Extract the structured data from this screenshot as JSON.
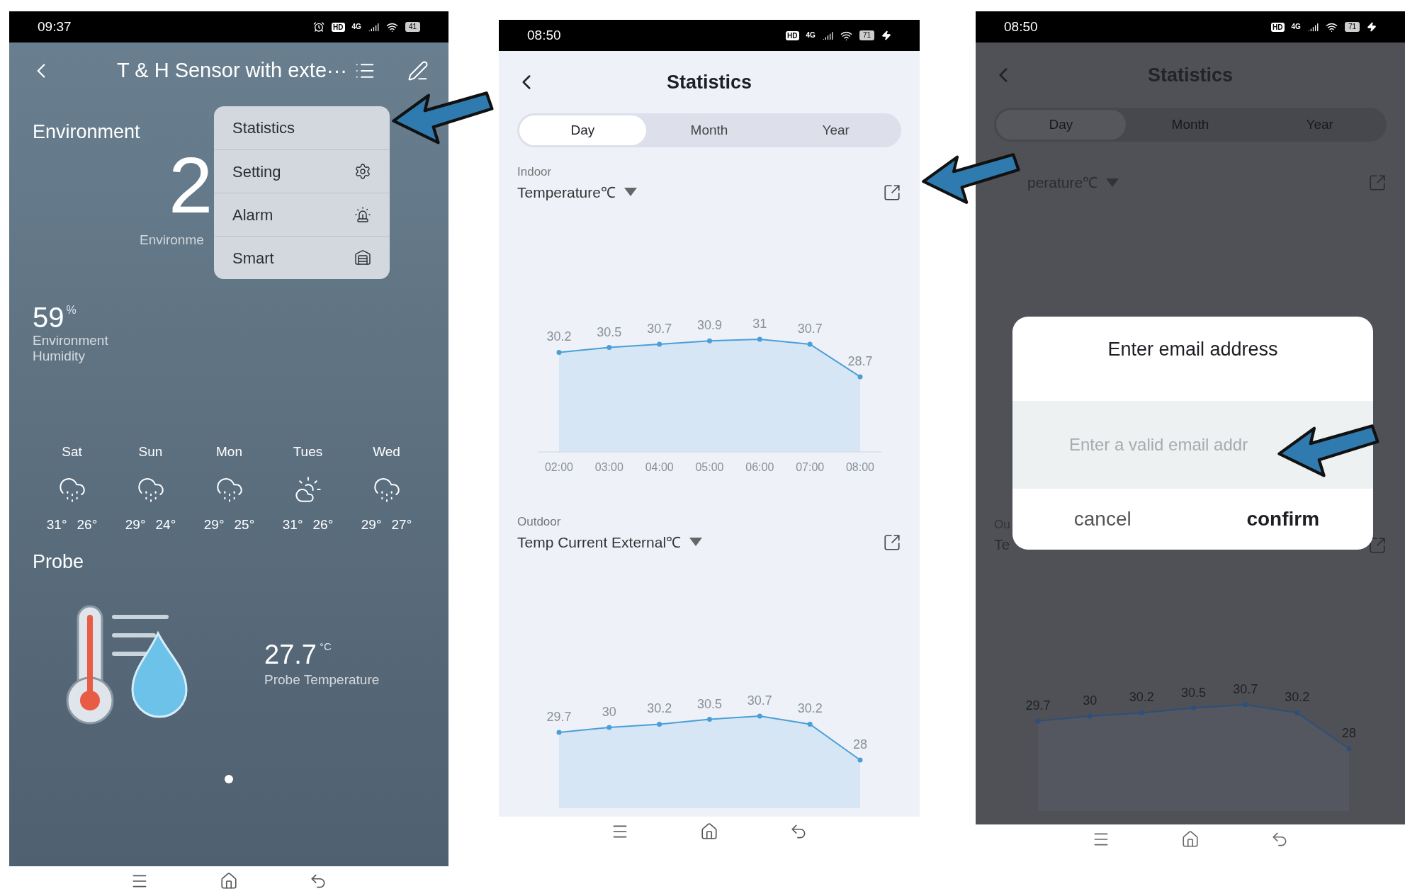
{
  "device_screen": {
    "status_bar": {
      "time": "09:37",
      "alarm": true,
      "hd": "HD",
      "network": "4G",
      "battery": "41"
    },
    "title": "T & H Sensor with exte···",
    "environment": {
      "heading": "Environment",
      "value": "2",
      "label": "Environme"
    },
    "menu": [
      {
        "label": "Statistics",
        "kind": "none"
      },
      {
        "label": "Setting",
        "kind": "gear"
      },
      {
        "label": "Alarm",
        "kind": "siren"
      },
      {
        "label": "Smart",
        "kind": "home"
      }
    ],
    "humidity": {
      "value": "59",
      "unit": "%",
      "label": "Environment Humidity"
    },
    "forecast": [
      {
        "day": "Sat",
        "kind": "rain",
        "high": "31°",
        "low": "26°"
      },
      {
        "day": "Sun",
        "kind": "rain",
        "high": "29°",
        "low": "24°"
      },
      {
        "day": "Mon",
        "kind": "rain",
        "high": "29°",
        "low": "25°"
      },
      {
        "day": "Tues",
        "kind": "sun_cloud",
        "high": "31°",
        "low": "26°"
      },
      {
        "day": "Wed",
        "kind": "rain",
        "high": "29°",
        "low": "27°"
      }
    ],
    "probe": {
      "heading": "Probe",
      "value": "27.7",
      "unit": "°C",
      "label": "Probe Temperature"
    }
  },
  "statistics_screen": {
    "status_bar": {
      "time": "08:50",
      "hd": "HD",
      "network": "4G",
      "battery": "71",
      "charging": true
    },
    "title": "Statistics",
    "tabs": [
      {
        "label": "Day",
        "selected": true
      },
      {
        "label": "Month",
        "selected": false
      },
      {
        "label": "Year",
        "selected": false
      }
    ],
    "indoor": {
      "label": "Indoor",
      "metric": "Temperature℃",
      "chart_data": {
        "type": "line",
        "categories": [
          "02:00",
          "03:00",
          "04:00",
          "05:00",
          "06:00",
          "07:00",
          "08:00"
        ],
        "data_labels": true,
        "series": [
          {
            "color": "#4a9fd8",
            "marker": true,
            "values": [
              30.2,
              30.5,
              30.7,
              30.9,
              31,
              30.7,
              28.7
            ]
          }
        ]
      }
    },
    "outdoor": {
      "label": "Outdoor",
      "metric": "Temp Current External℃",
      "chart_data": {
        "type": "line",
        "data_labels": true,
        "series": [
          {
            "color": "#4a9fd8",
            "marker": true,
            "values": [
              29.7,
              30,
              30.2,
              30.5,
              30.7,
              30.2,
              28
            ]
          }
        ]
      }
    }
  },
  "email_dialog_screen": {
    "status_bar": {
      "time": "08:50",
      "hd": "HD",
      "network": "4G",
      "battery": "71",
      "charging": true
    },
    "title": "Statistics",
    "tabs": [
      {
        "label": "Day",
        "selected": true
      },
      {
        "label": "Month",
        "selected": false
      },
      {
        "label": "Year",
        "selected": false
      }
    ],
    "indoor_metric": "perature℃",
    "outdoor_label": "Ou",
    "outdoor_metric": "Te",
    "chart_data": {
      "type": "line",
      "data_labels": true,
      "series": [
        {
          "color": "#2e4f7a",
          "marker": true,
          "values": [
            29.7,
            30,
            30.2,
            30.5,
            30.7,
            30.2,
            28
          ]
        }
      ]
    },
    "dialog": {
      "title": "Enter email address",
      "placeholder": "Enter a valid email addr",
      "buttons": [
        "cancel",
        "confirm"
      ]
    }
  }
}
